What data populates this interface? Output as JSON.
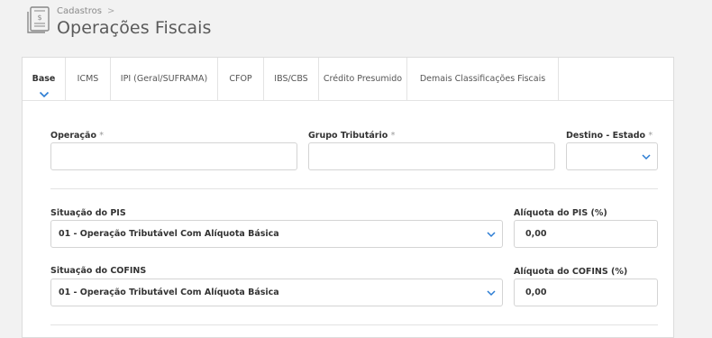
{
  "header": {
    "breadcrumb": "Cadastros",
    "breadcrumb_sep": ">",
    "title": "Operações Fiscais"
  },
  "tabs": [
    {
      "label": "Base",
      "active": true
    },
    {
      "label": "ICMS"
    },
    {
      "label": "IPI (Geral/SUFRAMA)"
    },
    {
      "label": "CFOP"
    },
    {
      "label": "IBS/CBS"
    },
    {
      "label": "Crédito Presumido"
    },
    {
      "label": "Demais Classificações Fiscais"
    }
  ],
  "form": {
    "required_mark": "*",
    "operacao": {
      "label": "Operação",
      "value": ""
    },
    "grupo_tributario": {
      "label": "Grupo Tributário",
      "value": ""
    },
    "destino_estado": {
      "label": "Destino - Estado",
      "value": ""
    },
    "situacao_pis": {
      "label": "Situação do PIS",
      "value": "01 - Operação Tributável Com Alíquota Básica"
    },
    "aliquota_pis": {
      "label": "Alíquota do PIS (%)",
      "value": "0,00"
    },
    "situacao_cofins": {
      "label": "Situação do COFINS",
      "value": "01 - Operação Tributável Com Alíquota Básica"
    },
    "aliquota_cofins": {
      "label": "Alíquota do COFINS (%)",
      "value": "0,00"
    }
  },
  "colors": {
    "accent": "#2b7cd3",
    "border": "#d4d4d4",
    "background": "#f2f2f2"
  }
}
